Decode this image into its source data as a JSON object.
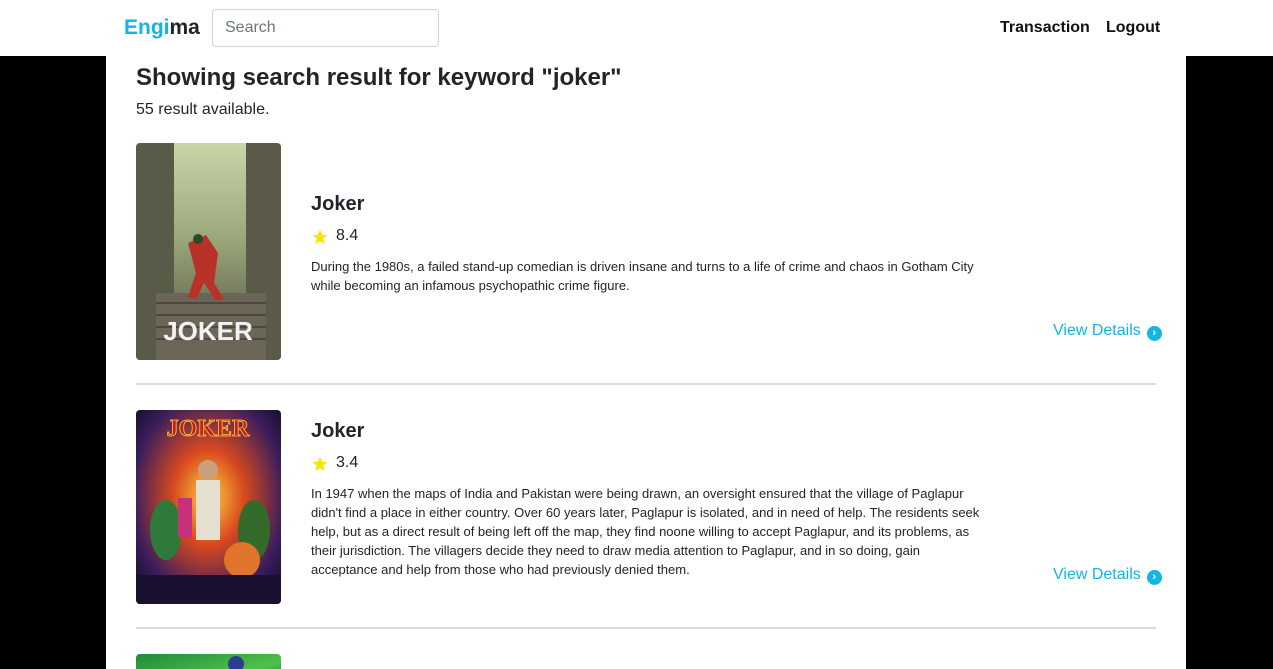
{
  "nav": {
    "brand_part1": "Engi",
    "brand_part2": "ma",
    "search_placeholder": "Search",
    "transaction_label": "Transaction",
    "logout_label": "Logout",
    "brand_color": "#12b5e5"
  },
  "results": {
    "heading": "Showing search result for keyword \"joker\"",
    "count_text": "55 result available."
  },
  "movies": [
    {
      "title": "Joker",
      "rating": "8.4",
      "description": "During the 1980s, a failed stand-up comedian is driven insane and turns to a life of crime and chaos in Gotham City while becoming an infamous psychopathic crime figure.",
      "view_label": "View Details",
      "poster_text": "JOKER"
    },
    {
      "title": "Joker",
      "rating": "3.4",
      "description": "In 1947 when the maps of India and Pakistan were being drawn, an oversight ensured that the village of Paglapur didn't find a place in either country. Over 60 years later, Paglapur is isolated, and in need of help. The residents seek help, but as a direct result of being left off the map, they find noone willing to accept Paglapur, and its problems, as their jurisdiction. The villagers decide they need to draw media attention to Paglapur, and in so doing, gain acceptance and help from those who had previously denied them.",
      "view_label": "View Details",
      "poster_text": "JOKER"
    }
  ],
  "icons": {
    "star": "star-icon",
    "view_arrow": "chevron-right-circle-icon"
  },
  "colors": {
    "accent": "#12b5e5",
    "star": "#f5e50a"
  }
}
